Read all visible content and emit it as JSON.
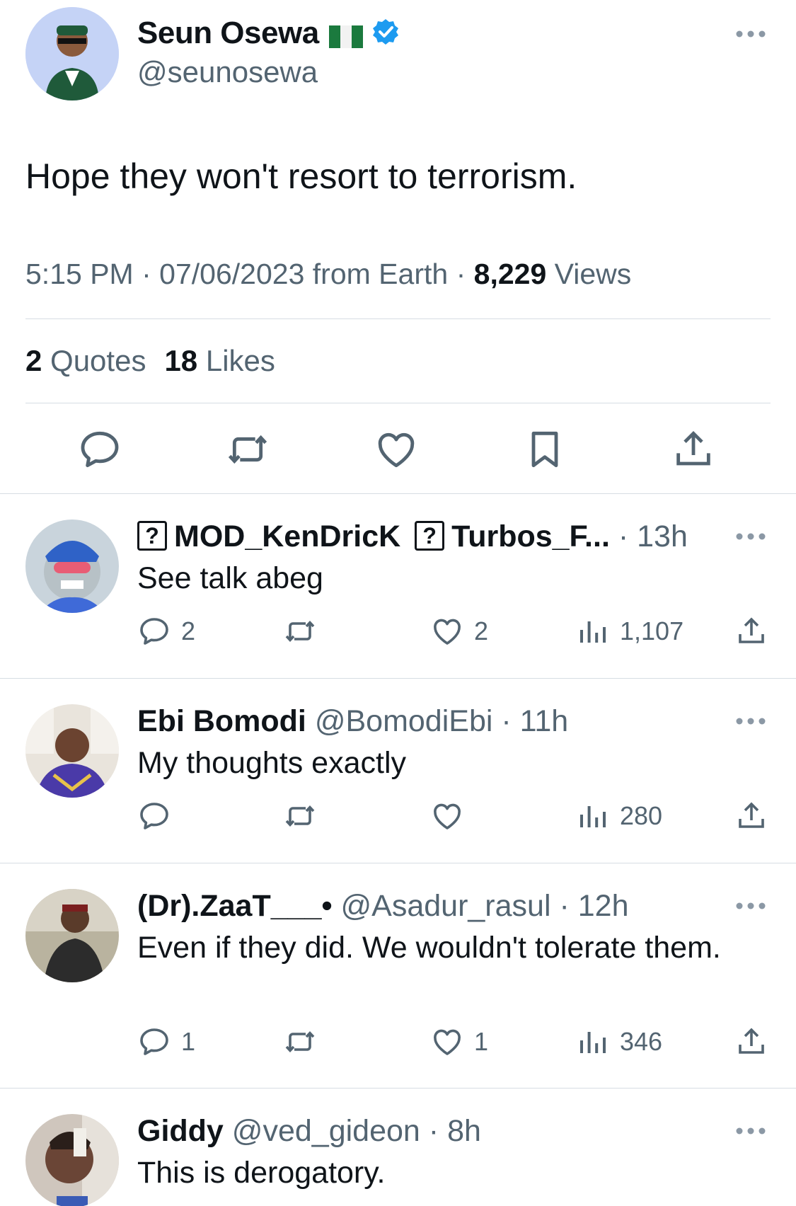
{
  "main_tweet": {
    "author_name": "Seun Osewa",
    "handle": "@seunosewa",
    "text": "Hope they won't resort to terrorism.",
    "time": "5:15 PM",
    "date": "07/06/2023",
    "source": "from Earth",
    "views_count": "8,229",
    "views_label": "Views",
    "quotes_count": "2",
    "quotes_label": "Quotes",
    "likes_count": "18",
    "likes_label": "Likes",
    "icons": [
      "reply-icon",
      "retweet-icon",
      "like-icon",
      "bookmark-icon",
      "share-icon"
    ]
  },
  "replies": [
    {
      "name": "MOD_KenDricK",
      "name_prefix_glyph": "?",
      "handle": "Turbos_F...",
      "handle_prefix_glyph": "?",
      "time": "13h",
      "text": "See talk abeg",
      "replies": "2",
      "retweets": "",
      "likes": "2",
      "views": "1,107"
    },
    {
      "name": "Ebi Bomodi",
      "handle": "@BomodiEbi",
      "time": "11h",
      "text": "My thoughts exactly",
      "replies": "",
      "retweets": "",
      "likes": "",
      "views": "280"
    },
    {
      "name": "(Dr).ZaaT___•",
      "handle": "@Asadur_rasul",
      "time": "12h",
      "text": "Even if they did. We wouldn't tolerate them.",
      "replies": "1",
      "retweets": "",
      "likes": "1",
      "views": "346"
    },
    {
      "name": "Giddy",
      "handle": "@ved_gideon",
      "time": "8h",
      "text": "This is derogatory."
    }
  ],
  "separator": "·",
  "colors": {
    "text": "#0f1419",
    "muted": "#536471",
    "verified_blue": "#1d9bf0",
    "divider": "#d6dde3",
    "flag_green": "#008751"
  }
}
